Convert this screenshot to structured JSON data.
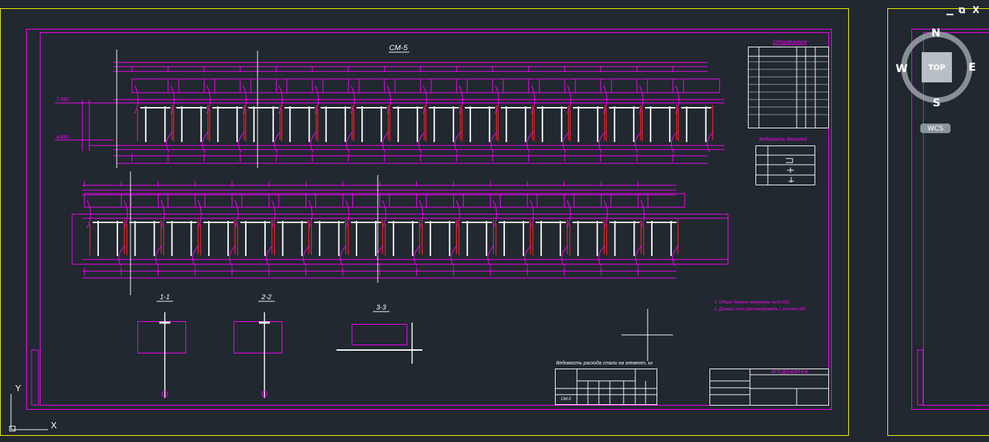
{
  "window_controls": {
    "minimize": "▁",
    "restore": "⧉",
    "close": "X"
  },
  "navcube": {
    "north": "N",
    "south": "S",
    "east": "E",
    "west": "W",
    "top": "TOP",
    "wcs": "WCS"
  },
  "ucs": {
    "x_label": "X",
    "y_label": "Y"
  },
  "drawing": {
    "main_title": "СМ-5",
    "sections": {
      "s11": "1-1",
      "s22": "2-2",
      "s33": "3-3"
    },
    "spec_title": "Спецификация",
    "notes_title": "Ведомость деталей",
    "steel_title": "Ведомость расхода стали на элемент, кг",
    "notes": [
      "1. Общие данные смотреть лист 002.",
      "2. Данный лист рассматривать с листом 002."
    ],
    "elev_top": "7.350",
    "elev_bottom": "4.850",
    "title_block_code": "АГП-ДЗ-ВЗП-КЖ",
    "mark_label": "СМ-5"
  },
  "colors": {
    "sheet_border": "#ffff00",
    "frame": "#ff00ff",
    "background": "#212830"
  }
}
